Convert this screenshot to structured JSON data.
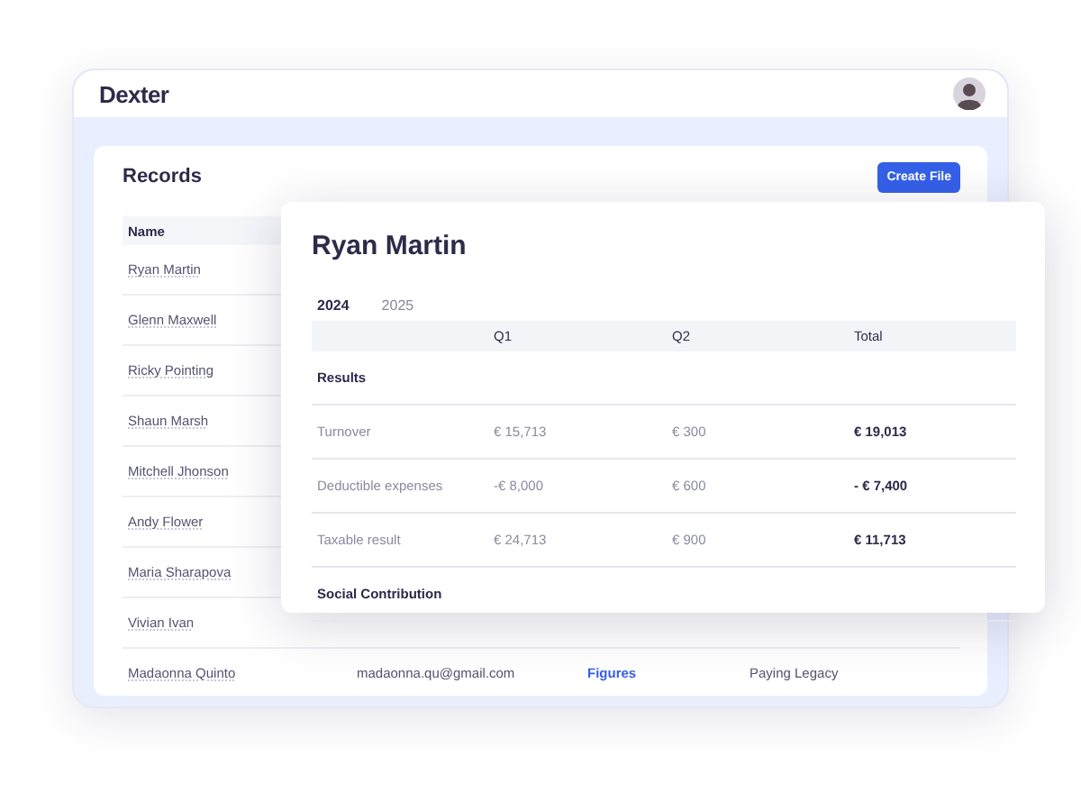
{
  "header": {
    "logo": "Dexter"
  },
  "records": {
    "title": "Records",
    "create_button": "Create File",
    "columns": [
      "Name"
    ],
    "rows": [
      {
        "name": "Ryan Martin"
      },
      {
        "name": "Glenn Maxwell"
      },
      {
        "name": "Ricky Pointing"
      },
      {
        "name": "Shaun Marsh"
      },
      {
        "name": "Mitchell Jhonson"
      },
      {
        "name": "Andy Flower"
      },
      {
        "name": "Maria Sharapova"
      },
      {
        "name": "Vivian Ivan"
      },
      {
        "name": "Madaonna Quinto",
        "email": "madaonna.qu@gmail.com",
        "link": "Figures",
        "status": "Paying Legacy"
      }
    ]
  },
  "detail": {
    "title": "Ryan Martin",
    "tabs": [
      {
        "label": "2024",
        "selected": true
      },
      {
        "label": "2025",
        "selected": false
      }
    ],
    "columns": [
      "Q1",
      "Q2",
      "Total"
    ],
    "rows": [
      {
        "kind": "section",
        "label": "Results"
      },
      {
        "kind": "data",
        "label": "Turnover",
        "values": [
          "€ 15,713",
          "€ 300",
          "€ 19,013"
        ]
      },
      {
        "kind": "data",
        "label": "Deductible expenses",
        "values": [
          "-€ 8,000",
          "€ 600",
          "- € 7,400"
        ]
      },
      {
        "kind": "data",
        "label": "Taxable result",
        "values": [
          "€ 24,713",
          "€ 900",
          "€ 11,713"
        ]
      },
      {
        "kind": "section",
        "label": "Social Contribution"
      }
    ]
  }
}
